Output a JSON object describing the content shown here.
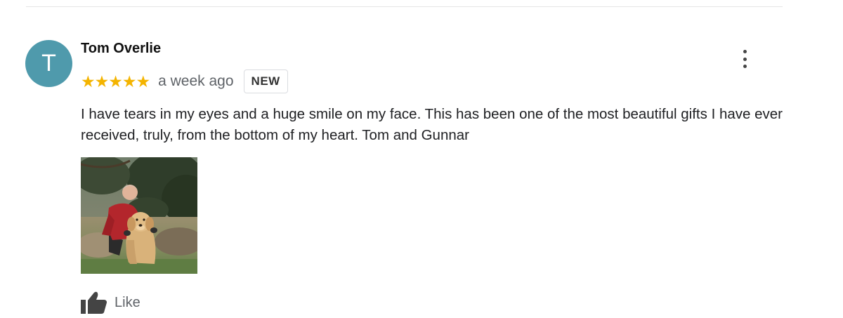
{
  "review": {
    "avatar_initial": "T",
    "author": "Tom Overlie",
    "rating": 5,
    "stars": [
      "★",
      "★",
      "★",
      "★",
      "★"
    ],
    "time": "a week ago",
    "badge": "NEW",
    "text": "I have tears in my eyes and a huge smile on my face. This has been one of the most beautiful gifts I have ever received, truly, from the bottom of my heart. Tom and Gunnar",
    "like_label": "Like"
  },
  "colors": {
    "avatar": "#4f9aac",
    "star": "#f4b400",
    "text": "#202124",
    "muted": "#5f6368"
  },
  "icons": {
    "menu": "more-vert-icon",
    "like": "thumbs-up-icon"
  }
}
